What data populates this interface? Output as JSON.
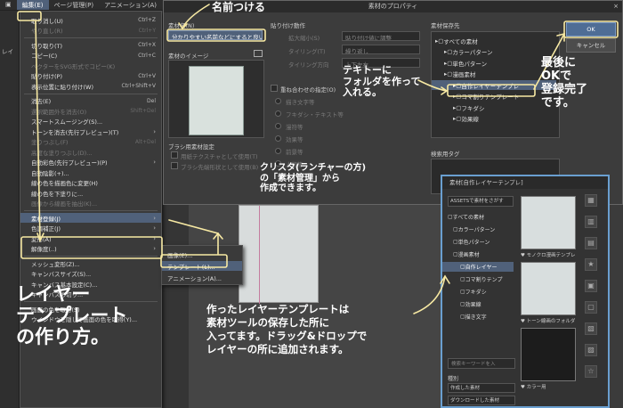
{
  "menubar": {
    "items": [
      {
        "label": "編集(E)",
        "active": true
      },
      {
        "label": "ページ管理(P)"
      },
      {
        "label": "アニメーション(A)"
      },
      {
        "label": "レイヤー(L)"
      }
    ]
  },
  "left": {
    "strip_label": "レイ",
    "panel_label": "ルヤ"
  },
  "edit_menu": {
    "items": [
      {
        "label": "取り消し(U)",
        "shortcut": "Ctrl+Z",
        "disabled": false
      },
      {
        "label": "やり直し(R)",
        "shortcut": "Ctrl+Y",
        "disabled": true
      },
      {
        "sep": true
      },
      {
        "label": "切り取り(T)",
        "shortcut": "Ctrl+X"
      },
      {
        "label": "コピー(C)",
        "shortcut": "Ctrl+C"
      },
      {
        "label": "ベクターをSVG形式でコピー(K)",
        "disabled": true
      },
      {
        "label": "貼り付け(P)",
        "shortcut": "Ctrl+V"
      },
      {
        "label": "表示位置に貼り付け(W)",
        "shortcut": "Ctrl+Shift+V"
      },
      {
        "sep": true
      },
      {
        "label": "消去(E)",
        "shortcut": "Del"
      },
      {
        "label": "選択範囲外を消去(O)",
        "shortcut": "Shift+Del",
        "disabled": true
      },
      {
        "label": "スマートスムージング(S)..."
      },
      {
        "label": "トーンを消去(先行プレビュー)(T)",
        "arrow": true
      },
      {
        "label": "塗りつぶし(F)",
        "shortcut": "Alt+Del",
        "disabled": true
      },
      {
        "label": "高度な塗りつぶし(D)...",
        "disabled": true
      },
      {
        "label": "自動彩色(先行プレビュー)(P)",
        "arrow": true
      },
      {
        "label": "自動陰影(+)..."
      },
      {
        "label": "線の色を描画色に変更(H)"
      },
      {
        "label": "線の色を下塗りに..."
      },
      {
        "label": "画像から線画を抽出(K)...",
        "disabled": true
      },
      {
        "sep": true
      },
      {
        "label": "素材登録(J)",
        "arrow": true,
        "highlight": true
      },
      {
        "label": "色調補正(J)",
        "arrow": true
      },
      {
        "label": "変形(A)",
        "arrow": true
      },
      {
        "label": "解像度(..)",
        "arrow": true
      },
      {
        "sep": true
      },
      {
        "label": "メッシュ変形(Z)..."
      },
      {
        "label": "キャンバスサイズ(S)..."
      },
      {
        "label": "キャンバス基本設定(C)..."
      },
      {
        "label": "キャンバスの切り..."
      },
      {
        "sep": true
      },
      {
        "label": "画面の色を取得(S)"
      },
      {
        "label": "ウインドウを隠して画面の色を取得(Y)..."
      }
    ]
  },
  "submenu": {
    "items": [
      {
        "label": "画像(E)..."
      },
      {
        "label": "テンプレート(L)...",
        "highlight": true
      },
      {
        "label": "アニメーション(A)..."
      }
    ]
  },
  "dialog": {
    "title": "素材のプロパティ",
    "close_icon": "×",
    "name_label": "素材名(N)",
    "name_value": "分かりやすい名前などにすると良い",
    "image_label": "素材のイメージ",
    "paste_section": "貼り付け動作",
    "paste_rows": [
      {
        "label": "拡大縮小(S)",
        "value": "貼り付け値に調整"
      },
      {
        "label": "タイリング(T)",
        "value": "繰り返し"
      },
      {
        "label": "タイリング方向",
        "value": "上下左右"
      }
    ],
    "overlap_label": "重ね合わせの指定(O)",
    "overlap_options": [
      "描き文字等",
      "フキダシ・テキスト等",
      "漫符等",
      "効果等",
      "前景等",
      "人物等"
    ],
    "save_section": "素材保存先",
    "tree": [
      {
        "label": "すべての素材",
        "indent": 0
      },
      {
        "label": "カラーパターン",
        "indent": 1
      },
      {
        "label": "単色パターン",
        "indent": 1
      },
      {
        "label": "漫画素材",
        "indent": 1
      },
      {
        "label": "自作レイヤーテンプレ",
        "indent": 2,
        "highlight": true
      },
      {
        "label": "コマ割りテンプレート",
        "indent": 2
      },
      {
        "label": "フキダシ",
        "indent": 2
      },
      {
        "label": "効果線",
        "indent": 2
      }
    ],
    "search_tag_label": "検索用タグ",
    "brush_label": "ブラシ用素材設定",
    "brush_opt1": "用紙テクスチャとして使用(T)",
    "brush_opt2": "ブラシ先端形状として使用(B)",
    "ok_label": "OK",
    "cancel_label": "キャンセル"
  },
  "material_panel": {
    "header": "素材[自作レイヤーテンプレ]",
    "assets_row": "ASSETSで素材をさがす",
    "tree": [
      {
        "label": "すべての素材"
      },
      {
        "label": "カラーパターン"
      },
      {
        "label": "単色パターン"
      },
      {
        "label": "漫画素材"
      },
      {
        "label": "自作レイヤー",
        "highlight": true
      },
      {
        "label": "コマ割りテンプ"
      },
      {
        "label": "フキダシ"
      },
      {
        "label": "効果線"
      },
      {
        "label": "描き文字"
      }
    ],
    "thumbs": [
      {
        "caption": "モノクロ漫画テンプレ",
        "dark": false
      },
      {
        "caption": "トーン線画のフォルダ",
        "dark": false
      },
      {
        "caption": "カラー用",
        "dark": true
      }
    ],
    "search_placeholder": "検索キーワードを入",
    "type_label": "種別",
    "created_label": "作成した素材",
    "download_label": "ダウンロードした素材"
  },
  "annotations": {
    "name_note": "名前つける",
    "temp_note": [
      "テキトーに",
      "フォルダを作って",
      "入れる。"
    ],
    "ok_note": [
      "最後に",
      "OKで",
      "登録完了",
      "です。"
    ],
    "clip_note": [
      "クリスタ(ランチャーの方)",
      "の「素材管理」から",
      "作成できます。"
    ],
    "made_note": [
      "作ったレイヤーテンプレートは",
      "素材ツールの保存した所に",
      "入ってます。ドラッグ&ドロップで",
      "レイヤーの所に追加されます。"
    ],
    "title_note": [
      "レイヤー",
      "テンプレート",
      "の作り方。"
    ]
  },
  "colors": {
    "annotation_yellow": "#f7e9a3",
    "highlight_blue": "#50617a",
    "panel_border": "#6a9fd0"
  }
}
